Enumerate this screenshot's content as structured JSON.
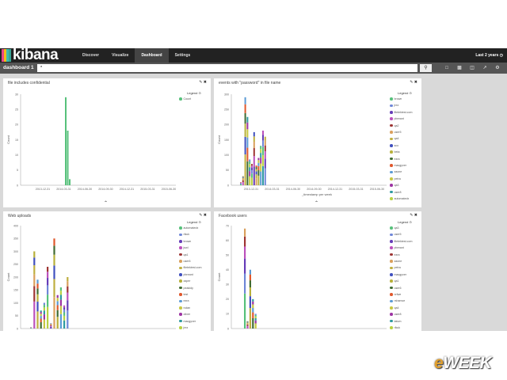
{
  "app": {
    "logo_text": "kibana",
    "logo_colors": [
      "#e8478b",
      "#f3bd19",
      "#3ebeb0",
      "#37a595"
    ],
    "nav_tabs": [
      {
        "label": "Discover",
        "active": false
      },
      {
        "label": "Visualize",
        "active": false
      },
      {
        "label": "Dashboard",
        "active": true
      },
      {
        "label": "Settings",
        "active": false
      }
    ],
    "time_range": "Last 2 years",
    "time_icon": "clock-icon"
  },
  "toolbar": {
    "dashboard_title": "dashboard 1",
    "search_value": "*",
    "search_icon": "search-icon",
    "tool_icons": [
      "new-dashboard-icon",
      "save-icon",
      "open-icon",
      "share-icon",
      "settings-gear-icon"
    ]
  },
  "panels": [
    {
      "title": "file includes confidential",
      "controls": "✎ ✖",
      "legend_title": "Legend ⊙",
      "legend": [
        {
          "label": "Count",
          "color": "#57c17b"
        }
      ]
    },
    {
      "title": "events with \"password\" in file name",
      "controls": "✎ ✖",
      "legend_title": "Legend ⊙",
      "legend": [
        {
          "label": "brown",
          "color": "#57c17b"
        },
        {
          "label": "jrez",
          "color": "#6f87d8"
        },
        {
          "label": "filetektest.com",
          "color": "#663db8"
        },
        {
          "label": "pbreant",
          "color": "#bc52bc"
        },
        {
          "label": "qa2",
          "color": "#9e3533"
        },
        {
          "label": "user5",
          "color": "#daa05d"
        },
        {
          "label": "qa4",
          "color": "#bfaf40"
        },
        {
          "label": "sco",
          "color": "#4050bf"
        },
        {
          "label": "beta",
          "color": "#b8b03a"
        },
        {
          "label": "ezra",
          "color": "#406c33"
        },
        {
          "label": "macgyver",
          "color": "#e0582c"
        },
        {
          "label": "zaone",
          "color": "#5b9bd5"
        },
        {
          "label": "petra",
          "color": "#c7c742"
        },
        {
          "label": "qa3",
          "color": "#9d34a3"
        },
        {
          "label": "user8",
          "color": "#2e9aa0"
        },
        {
          "label": "automatedx",
          "color": "#b8d143"
        }
      ]
    },
    {
      "title": "Web uploads",
      "controls": "✎ ✖",
      "legend_title": "Legend ⊙",
      "legend": [
        {
          "label": "automatedx",
          "color": "#57c17b"
        },
        {
          "label": "rikuk",
          "color": "#6f87d8"
        },
        {
          "label": "brown",
          "color": "#663db8"
        },
        {
          "label": "jswl",
          "color": "#bc52bc"
        },
        {
          "label": "qa1",
          "color": "#9e3533"
        },
        {
          "label": "user6",
          "color": "#daa05d"
        },
        {
          "label": "filetektest.com",
          "color": "#bfaf40"
        },
        {
          "label": "pbreant",
          "color": "#4050bf"
        },
        {
          "label": "zaper",
          "color": "#b8b03a"
        },
        {
          "label": "peakidy",
          "color": "#406c33"
        },
        {
          "label": "test",
          "color": "#e0582c"
        },
        {
          "label": "ezra",
          "color": "#5b9bd5"
        },
        {
          "label": "nolan",
          "color": "#c7c742"
        },
        {
          "label": "oliver",
          "color": "#9d34a3"
        },
        {
          "label": "macgyver",
          "color": "#2e9aa0"
        },
        {
          "label": "jrez",
          "color": "#b8d143"
        }
      ]
    },
    {
      "title": "Facebook users",
      "controls": "✎ ✖",
      "legend_title": "Legend ⊙",
      "legend": [
        {
          "label": "qa3",
          "color": "#57c17b"
        },
        {
          "label": "user5",
          "color": "#6f87d8"
        },
        {
          "label": "filetektest.com",
          "color": "#663db8"
        },
        {
          "label": "pbreant",
          "color": "#bc52bc"
        },
        {
          "label": "ezra",
          "color": "#9e3533"
        },
        {
          "label": "zaone",
          "color": "#daa05d"
        },
        {
          "label": "petra",
          "color": "#bfaf40"
        },
        {
          "label": "macgyver",
          "color": "#4050bf"
        },
        {
          "label": "qa1",
          "color": "#b8b03a"
        },
        {
          "label": "user6",
          "color": "#406c33"
        },
        {
          "label": "nrfwe",
          "color": "#e0582c"
        },
        {
          "label": "rshamce",
          "color": "#5b9bd5"
        },
        {
          "label": "qa4",
          "color": "#c7c742"
        },
        {
          "label": "user8",
          "color": "#9d34a3"
        },
        {
          "label": "tatum",
          "color": "#2e9aa0"
        },
        {
          "label": "rikuk",
          "color": "#b8d143"
        }
      ]
    }
  ],
  "chart_data": [
    {
      "type": "bar",
      "title": "file includes confidential",
      "ylabel": "Count",
      "xlabel": "",
      "ylim": [
        0,
        30
      ],
      "yticks": [
        0,
        5,
        10,
        15,
        20,
        25,
        30
      ],
      "xticks": [
        "2013-12-31",
        "2014-03-31",
        "2014-06-30",
        "2014-09-30",
        "2014-12-31",
        "2015-03-31",
        "2015-06-30"
      ],
      "categories": [
        "2014-03-24",
        "2014-03-31",
        "2014-04-07"
      ],
      "series": [
        {
          "name": "Count",
          "values": [
            29,
            18,
            2
          ]
        }
      ]
    },
    {
      "type": "bar",
      "title": "events with \"password\" in file name",
      "ylabel": "Count",
      "xlabel": "_timestamp per week",
      "ylim": [
        0,
        300
      ],
      "yticks": [
        0,
        50,
        100,
        150,
        200,
        250,
        300
      ],
      "xticks": [
        "2013-12-31",
        "2014-03-31",
        "2014-06-30",
        "2014-09-30",
        "2014-12-31",
        "2015-03-31",
        "2015-06-30"
      ],
      "values": [
        10,
        30,
        290,
        225,
        85,
        70,
        175,
        65,
        90,
        130,
        180,
        160
      ]
    },
    {
      "type": "bar",
      "title": "Web uploads",
      "ylabel": "Count",
      "xlabel": "",
      "ylim": [
        0,
        400
      ],
      "yticks": [
        0,
        50,
        100,
        150,
        200,
        250,
        300,
        350,
        400
      ],
      "values": [
        5,
        300,
        190,
        70,
        100,
        240,
        20,
        350,
        130,
        160,
        90,
        200
      ]
    },
    {
      "type": "bar",
      "title": "Facebook users",
      "ylabel": "Count",
      "xlabel": "",
      "ylim": [
        0,
        70
      ],
      "yticks": [
        0,
        10,
        20,
        30,
        40,
        50,
        60,
        70
      ],
      "values": [
        68,
        5,
        40,
        20,
        10
      ]
    }
  ],
  "watermark": {
    "text_e": "e",
    "text_rest": "WEEK"
  }
}
